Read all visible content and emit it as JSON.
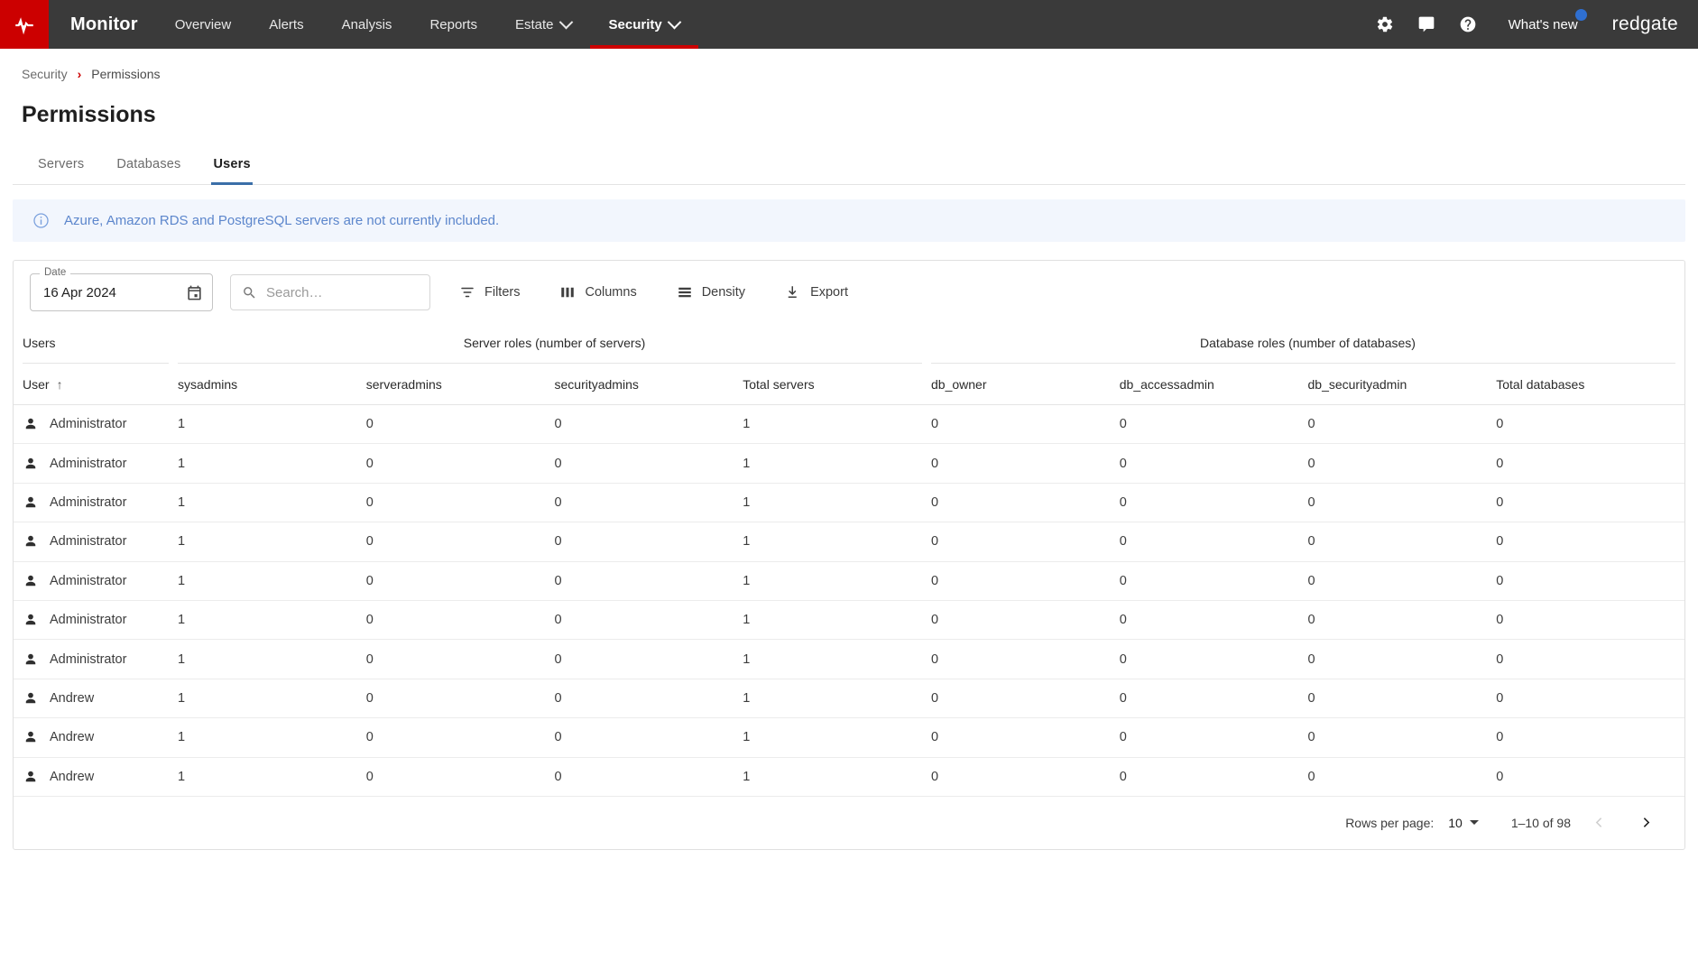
{
  "topnav": {
    "logo_icon": "redgate-monitor-logo-icon",
    "brand": "Monitor",
    "items": [
      {
        "label": "Overview",
        "has_caret": false,
        "active": false
      },
      {
        "label": "Alerts",
        "has_caret": false,
        "active": false
      },
      {
        "label": "Analysis",
        "has_caret": false,
        "active": false
      },
      {
        "label": "Reports",
        "has_caret": false,
        "active": false
      },
      {
        "label": "Estate",
        "has_caret": true,
        "active": false
      },
      {
        "label": "Security",
        "has_caret": true,
        "active": true
      }
    ],
    "right": {
      "settings_icon": "gear-icon",
      "feedback_icon": "chat-bubble-icon",
      "help_icon": "question-mark-circle-icon",
      "whats_new": "What's new",
      "whats_new_badge": true,
      "company": "redgate"
    },
    "bg_color": "#3a3a3a",
    "accent_color": "#cc0000"
  },
  "breadcrumb": {
    "items": [
      "Security",
      "Permissions"
    ],
    "separator": "›"
  },
  "page_title": "Permissions",
  "tabs": [
    {
      "label": "Servers",
      "active": false
    },
    {
      "label": "Databases",
      "active": false
    },
    {
      "label": "Users",
      "active": true
    }
  ],
  "banner": {
    "icon": "info-circle-icon",
    "text": "Azure, Amazon RDS and PostgreSQL servers are not currently included.",
    "bg_color": "#f2f6fd",
    "text_color": "#5c86cc"
  },
  "toolbar": {
    "date_label": "Date",
    "date_value": "16 Apr 2024",
    "calendar_icon": "calendar-icon",
    "search_icon": "search-icon",
    "search_value": "",
    "search_placeholder": "Search…",
    "buttons": [
      {
        "label": "Filters",
        "icon": "filter-icon"
      },
      {
        "label": "Columns",
        "icon": "columns-icon"
      },
      {
        "label": "Density",
        "icon": "density-icon"
      },
      {
        "label": "Export",
        "icon": "download-icon"
      }
    ]
  },
  "table": {
    "group_headers": [
      "Users",
      "Server roles (number of servers)",
      "Database roles (number of databases)"
    ],
    "columns": [
      {
        "label": "User",
        "sorted": true,
        "sort_dir": "↑"
      },
      {
        "label": "sysadmins"
      },
      {
        "label": "serveradmins"
      },
      {
        "label": "securityadmins"
      },
      {
        "label": "Total servers"
      },
      {
        "label": "db_owner"
      },
      {
        "label": "db_accessadmin"
      },
      {
        "label": "db_securityadmin"
      },
      {
        "label": "Total databases"
      }
    ],
    "row_icon": "person-icon",
    "rows": [
      {
        "user": "Administrator",
        "values": [
          "1",
          "0",
          "0",
          "1",
          "0",
          "0",
          "0",
          "0"
        ]
      },
      {
        "user": "Administrator",
        "values": [
          "1",
          "0",
          "0",
          "1",
          "0",
          "0",
          "0",
          "0"
        ]
      },
      {
        "user": "Administrator",
        "values": [
          "1",
          "0",
          "0",
          "1",
          "0",
          "0",
          "0",
          "0"
        ]
      },
      {
        "user": "Administrator",
        "values": [
          "1",
          "0",
          "0",
          "1",
          "0",
          "0",
          "0",
          "0"
        ]
      },
      {
        "user": "Administrator",
        "values": [
          "1",
          "0",
          "0",
          "1",
          "0",
          "0",
          "0",
          "0"
        ]
      },
      {
        "user": "Administrator",
        "values": [
          "1",
          "0",
          "0",
          "1",
          "0",
          "0",
          "0",
          "0"
        ]
      },
      {
        "user": "Administrator",
        "values": [
          "1",
          "0",
          "0",
          "1",
          "0",
          "0",
          "0",
          "0"
        ]
      },
      {
        "user": "Andrew",
        "values": [
          "1",
          "0",
          "0",
          "1",
          "0",
          "0",
          "0",
          "0"
        ]
      },
      {
        "user": "Andrew",
        "values": [
          "1",
          "0",
          "0",
          "1",
          "0",
          "0",
          "0",
          "0"
        ]
      },
      {
        "user": "Andrew",
        "values": [
          "1",
          "0",
          "0",
          "1",
          "0",
          "0",
          "0",
          "0"
        ]
      }
    ]
  },
  "pagination": {
    "rows_per_page_label": "Rows per page:",
    "rows_per_page_value": "10",
    "range": "1–10 of 98",
    "prev_enabled": false,
    "next_enabled": true
  }
}
